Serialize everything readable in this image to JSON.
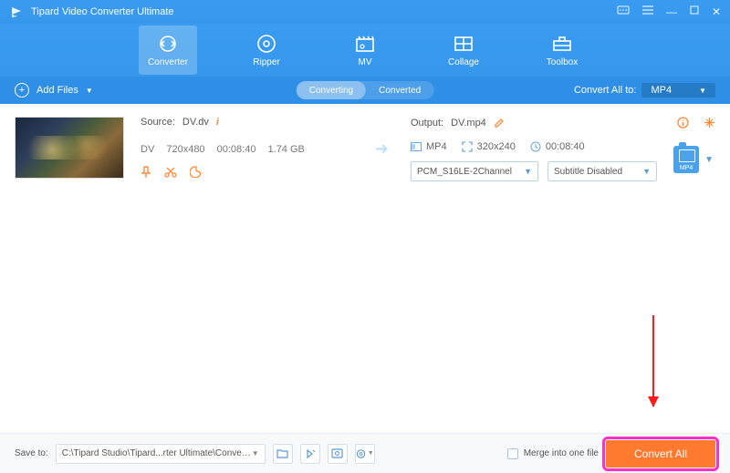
{
  "app": {
    "title": "Tipard Video Converter Ultimate"
  },
  "toolbar": {
    "tabs": [
      {
        "label": "Converter"
      },
      {
        "label": "Ripper"
      },
      {
        "label": "MV"
      },
      {
        "label": "Collage"
      },
      {
        "label": "Toolbox"
      }
    ]
  },
  "subbar": {
    "add_files": "Add Files",
    "mode": {
      "converting": "Converting",
      "converted": "Converted"
    },
    "convert_all_to_label": "Convert All to:",
    "convert_all_format": "MP4"
  },
  "item": {
    "source": {
      "label": "Source:",
      "filename": "DV.dv",
      "container": "DV",
      "resolution": "720x480",
      "duration": "00:08:40",
      "size": "1.74 GB"
    },
    "output": {
      "label": "Output:",
      "filename": "DV.mp4",
      "container": "MP4",
      "resolution": "320x240",
      "duration": "00:08:40",
      "audio_sel": "PCM_S16LE-2Channel",
      "subtitle_sel": "Subtitle Disabled",
      "badge": "MP4"
    }
  },
  "footer": {
    "save_to_label": "Save to:",
    "path": "C:\\Tipard Studio\\Tipard...rter Ultimate\\Converted",
    "merge_label": "Merge into one file",
    "convert_btn": "Convert All"
  }
}
